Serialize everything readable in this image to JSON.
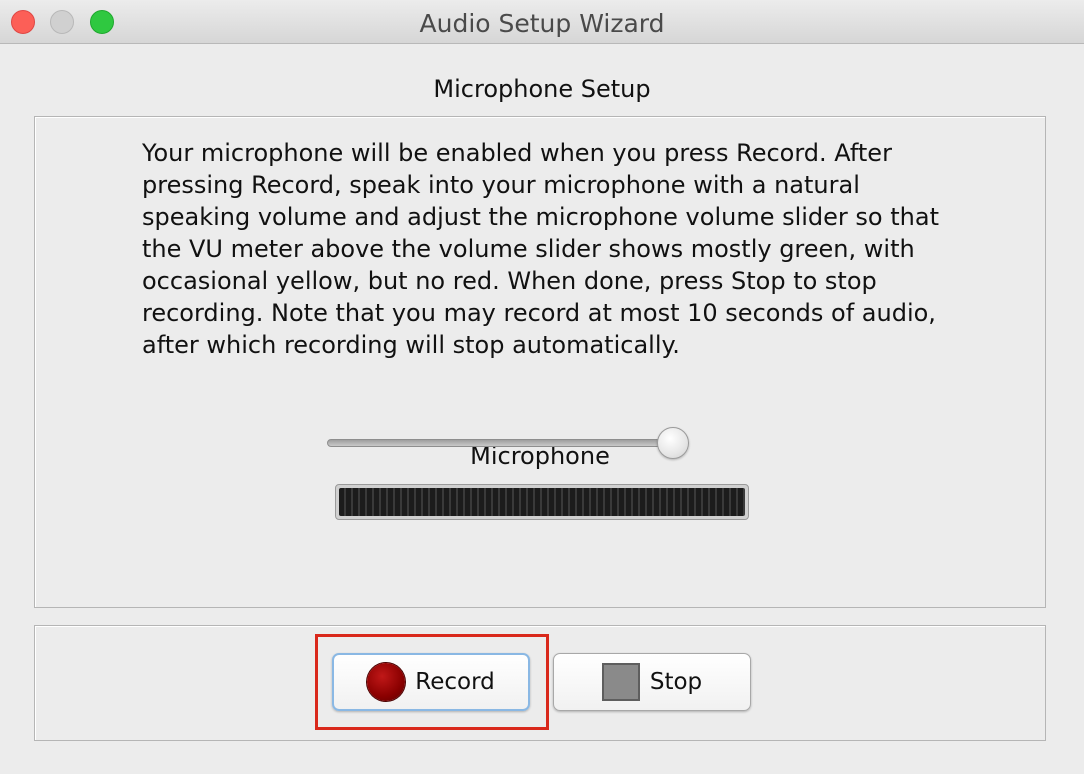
{
  "window": {
    "title": "Audio Setup Wizard"
  },
  "main": {
    "heading": "Microphone Setup",
    "instructions": "Your microphone will be enabled when you press Record. After pressing Record, speak into your microphone with a natural speaking volume and adjust the microphone volume slider so that the VU meter above the volume slider shows mostly green, with occasional yellow, but no red. When done, press Stop to stop recording. Note that you may record at most 10 seconds of audio, after which recording will stop automatically.",
    "microphone_label": "Microphone",
    "volume_slider_value_percent": 100,
    "vu_meter_level_percent": 0
  },
  "buttons": {
    "record_label": "Record",
    "stop_label": "Stop"
  },
  "icons": {
    "record": "record-circle-icon",
    "stop": "stop-square-icon"
  },
  "colors": {
    "highlight": "#d9281b",
    "record_dot": "#8a0000",
    "stop_square": "#8a8a8a"
  }
}
